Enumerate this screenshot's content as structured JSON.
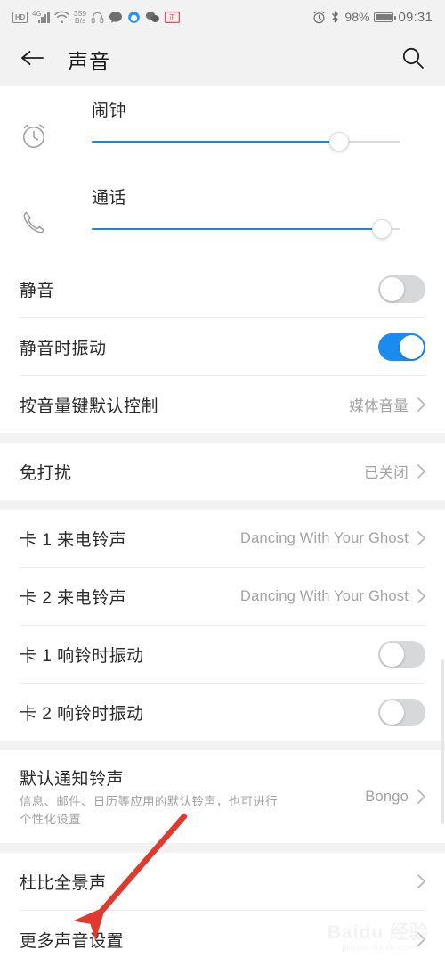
{
  "statusbar": {
    "hd_badge": "HD",
    "network_type": "4G",
    "net_speed_value": "359",
    "net_speed_unit": "B/s",
    "icons": [
      "hd-badge",
      "signal-bars-icon",
      "wifi-icon",
      "network-speed-icon",
      "headset-icon",
      "message-bubble-icon",
      "browser-icon",
      "wechat-icon",
      "app-badge-icon",
      "alarm-icon",
      "bluetooth-icon"
    ],
    "battery_percent": "98%",
    "time": "09:31"
  },
  "appbar": {
    "back_icon": "back-arrow-icon",
    "title": "声音",
    "search_icon": "search-icon"
  },
  "sliders": [
    {
      "icon": "alarm-clock-icon",
      "label": "闹钟",
      "value": 80
    },
    {
      "icon": "phone-handset-icon",
      "label": "通话",
      "value": 94
    }
  ],
  "toggles_section": [
    {
      "label": "静音",
      "state": "off"
    },
    {
      "label": "静音时振动",
      "state": "on"
    }
  ],
  "volume_key_row": {
    "label": "按音量键默认控制",
    "value": "媒体音量"
  },
  "dnd_row": {
    "label": "免打扰",
    "value": "已关闭"
  },
  "ringtone_rows": [
    {
      "label": "卡 1 来电铃声",
      "value": "Dancing With Your Ghost"
    },
    {
      "label": "卡 2 来电铃声",
      "value": "Dancing With Your Ghost"
    }
  ],
  "ring_vibrate_rows": [
    {
      "label": "卡 1 响铃时振动",
      "state": "off"
    },
    {
      "label": "卡 2 响铃时振动",
      "state": "off"
    }
  ],
  "notification_row": {
    "label": "默认通知铃声",
    "sublabel": "信息、邮件、日历等应用的默认铃声，也可进行个性化设置",
    "value": "Bongo"
  },
  "bottom_rows": [
    {
      "label": "杜比全景声",
      "value": ""
    },
    {
      "label": "更多声音设置",
      "value": ""
    }
  ],
  "annotation": {
    "type": "arrow",
    "color": "#e0392e",
    "points_to": "更多声音设置"
  },
  "watermark": {
    "main": "Baidu 经验",
    "sub": "jingyan.baidu.com"
  },
  "colors": {
    "accent_blue": "#1a8cf0",
    "slider_blue": "#1a87d8",
    "bg_gray": "#f2f2f2",
    "text_primary": "#2a2a2a",
    "text_secondary": "#a3a3a3",
    "annotation_red": "#e0392e"
  }
}
